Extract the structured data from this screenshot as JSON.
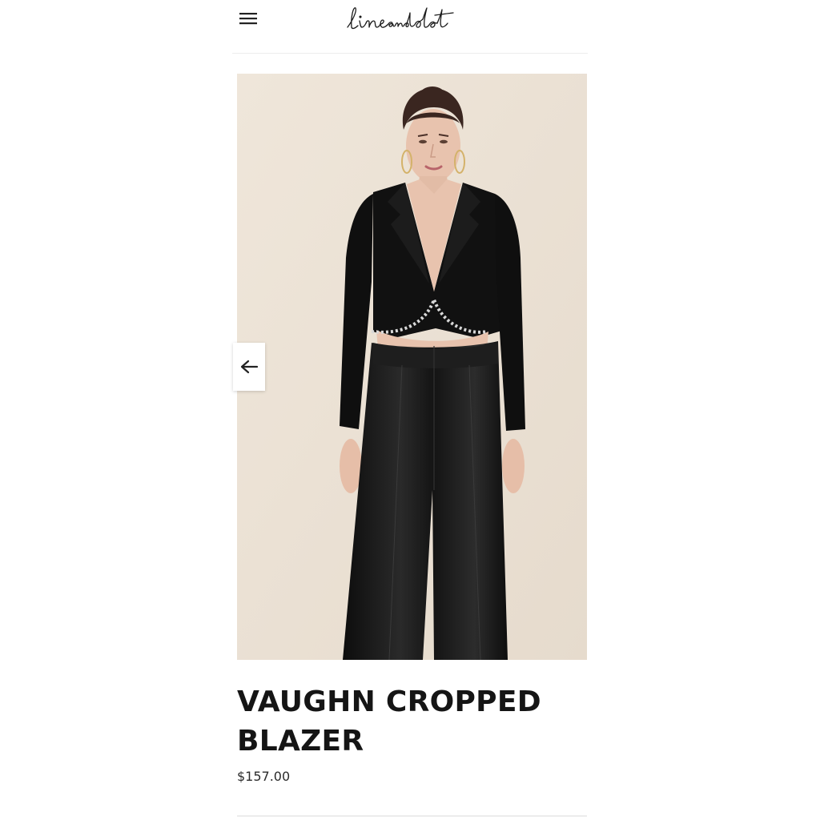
{
  "header": {
    "menu_icon": "hamburger-menu-icon",
    "logo_text": "lineanddot"
  },
  "product": {
    "title": "VAUGHN CROPPED BLAZER",
    "price": "$157.00",
    "image_description_icon": "product-photo"
  },
  "gallery": {
    "prev_icon": "arrow-left-icon"
  },
  "colors": {
    "background": "#ffffff",
    "photo_backdrop": "#ede3d6",
    "garment": "#111111",
    "text": "#151515",
    "divider": "#ececec"
  }
}
